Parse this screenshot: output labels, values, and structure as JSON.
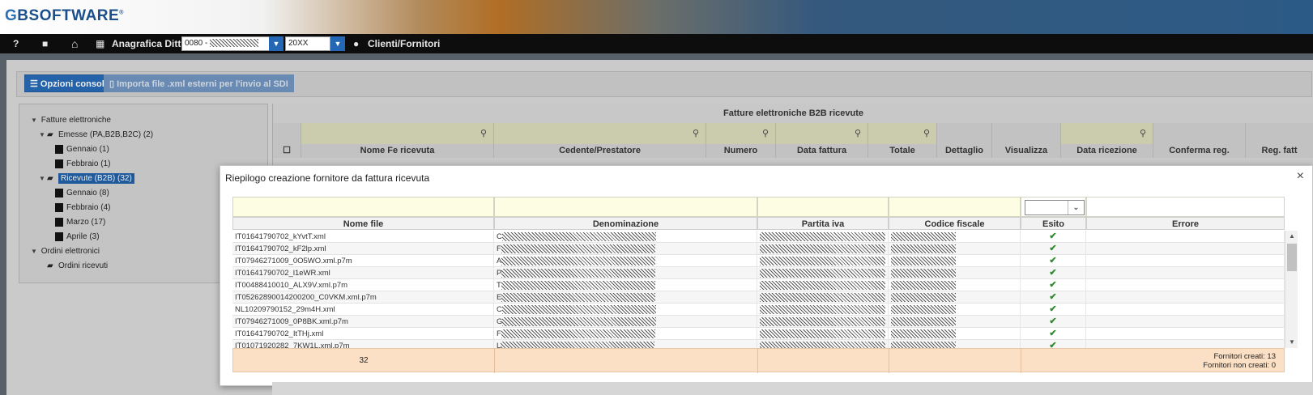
{
  "header": {
    "logo_prefix": "G",
    "logo_b": "B",
    "logo_text": "SOFTWARE",
    "logo_mark": "®"
  },
  "nav": {
    "help_icon": "?",
    "video_icon": "■",
    "home_icon": "⌂",
    "building_icon": "▦",
    "module_label": "Anagrafica Ditte",
    "company_value": "0080 - ",
    "year_value": "20XX",
    "user_icon": "●",
    "clients_label": "Clienti/Fornitori"
  },
  "toolbar": {
    "options_label": "Opzioni console",
    "import_label": "Importa file .xml esterni per l'invio al SDI"
  },
  "tree": [
    {
      "label": "Fatture elettroniche",
      "level": 0,
      "kind": "root"
    },
    {
      "label": "Emesse (PA,B2B,B2C) (2)",
      "level": 1,
      "kind": "folder"
    },
    {
      "label": "Gennaio (1)",
      "level": 2,
      "kind": "doc"
    },
    {
      "label": "Febbraio (1)",
      "level": 2,
      "kind": "doc"
    },
    {
      "label": "Ricevute (B2B) (32)",
      "level": 1,
      "kind": "folder",
      "selected": true
    },
    {
      "label": "Gennaio (8)",
      "level": 2,
      "kind": "doc"
    },
    {
      "label": "Febbraio (4)",
      "level": 2,
      "kind": "doc"
    },
    {
      "label": "Marzo (17)",
      "level": 2,
      "kind": "doc"
    },
    {
      "label": "Aprile (3)",
      "level": 2,
      "kind": "doc"
    },
    {
      "label": "Ordini elettronici",
      "level": 0,
      "kind": "root"
    },
    {
      "label": "Ordini ricevuti",
      "level": 1,
      "kind": "folder"
    }
  ],
  "grid": {
    "title": "Fatture elettroniche B2B ricevute",
    "columns": [
      "Nome Fe ricevuta",
      "Cedente/Prestatore",
      "Numero",
      "Data fattura",
      "Totale",
      "Dettaglio",
      "Visualizza",
      "Data ricezione",
      "Conferma reg.",
      "Reg. fatt"
    ]
  },
  "modal": {
    "title": "Riepilogo creazione fornitore da fattura ricevuta",
    "close_icon": "×",
    "columns": [
      "Nome file",
      "Denominazione",
      "Partita iva",
      "Codice fiscale",
      "Esito",
      "Errore"
    ],
    "rows": [
      {
        "file": "IT01641790702_kYvtT.xml",
        "den_prefix": "C",
        "piva_prefix": "",
        "cf_prefix": "",
        "esito": "✔"
      },
      {
        "file": "IT01641790702_kF2lp.xml",
        "den_prefix": "F",
        "piva_prefix": "",
        "cf_prefix": "",
        "esito": "✔"
      },
      {
        "file": "IT07946271009_0O5WO.xml.p7m",
        "den_prefix": "A",
        "piva_prefix": "",
        "cf_prefix": "",
        "esito": "✔"
      },
      {
        "file": "IT01641790702_l1eWR.xml",
        "den_prefix": "P",
        "piva_prefix": "",
        "cf_prefix": "",
        "esito": "✔"
      },
      {
        "file": "IT00488410010_ALX9V.xml.p7m",
        "den_prefix": "T",
        "piva_prefix": "",
        "cf_prefix": "",
        "esito": "✔"
      },
      {
        "file": "IT05262890014200200_C0VKM.xml.p7m",
        "den_prefix": "E",
        "piva_prefix": "",
        "cf_prefix": "",
        "esito": "✔"
      },
      {
        "file": "NL10209790152_29m4H.xml",
        "den_prefix": "C",
        "piva_prefix": "",
        "cf_prefix": "",
        "esito": "✔"
      },
      {
        "file": "IT07946271009_0P8BK.xml.p7m",
        "den_prefix": "G",
        "piva_prefix": "",
        "cf_prefix": "",
        "esito": "✔"
      },
      {
        "file": "IT01641790702_ItTHj.xml",
        "den_prefix": "F",
        "piva_prefix": "",
        "cf_prefix": "",
        "esito": "✔"
      },
      {
        "file": "IT01071920282_7KW1L.xml.p7m",
        "den_prefix": "L",
        "piva_prefix": "",
        "cf_prefix": "",
        "esito": "✔"
      }
    ],
    "footer": {
      "count": "32",
      "created": "Fornitori creati: 13",
      "not_created": "Fornitori non creati: 0"
    }
  }
}
